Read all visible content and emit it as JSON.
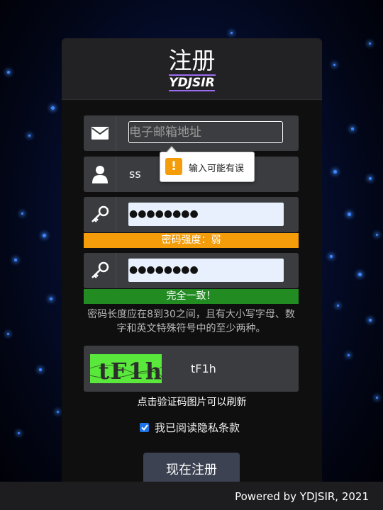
{
  "header": {
    "title": "注册",
    "subtitle": "YDJSIR"
  },
  "email": {
    "placeholder": "电子邮箱地址",
    "tooltip": {
      "icon_char": "!",
      "text": "输入可能有误"
    }
  },
  "username": {
    "value": "ss"
  },
  "password": {
    "value": "●●●●●●●●",
    "strength_text": "密码强度：弱",
    "strength_color": "#f59c0a"
  },
  "confirm": {
    "value": "●●●●●●●●",
    "match_text": "完全一致！",
    "match_color": "#228b22"
  },
  "hint": "密码长度应在8到30之间，且有大小写字母、数字和英文特殊符号中的至少两种。",
  "captcha": {
    "image_text": "tF1h",
    "value": "tF1h",
    "refresh_text": "点击验证码图片可以刷新"
  },
  "agree": {
    "checked": true,
    "label": "我已阅读隐私条款"
  },
  "submit_label": "现在注册",
  "footer": {
    "text": "Powered by YDJSIR, 2021"
  }
}
